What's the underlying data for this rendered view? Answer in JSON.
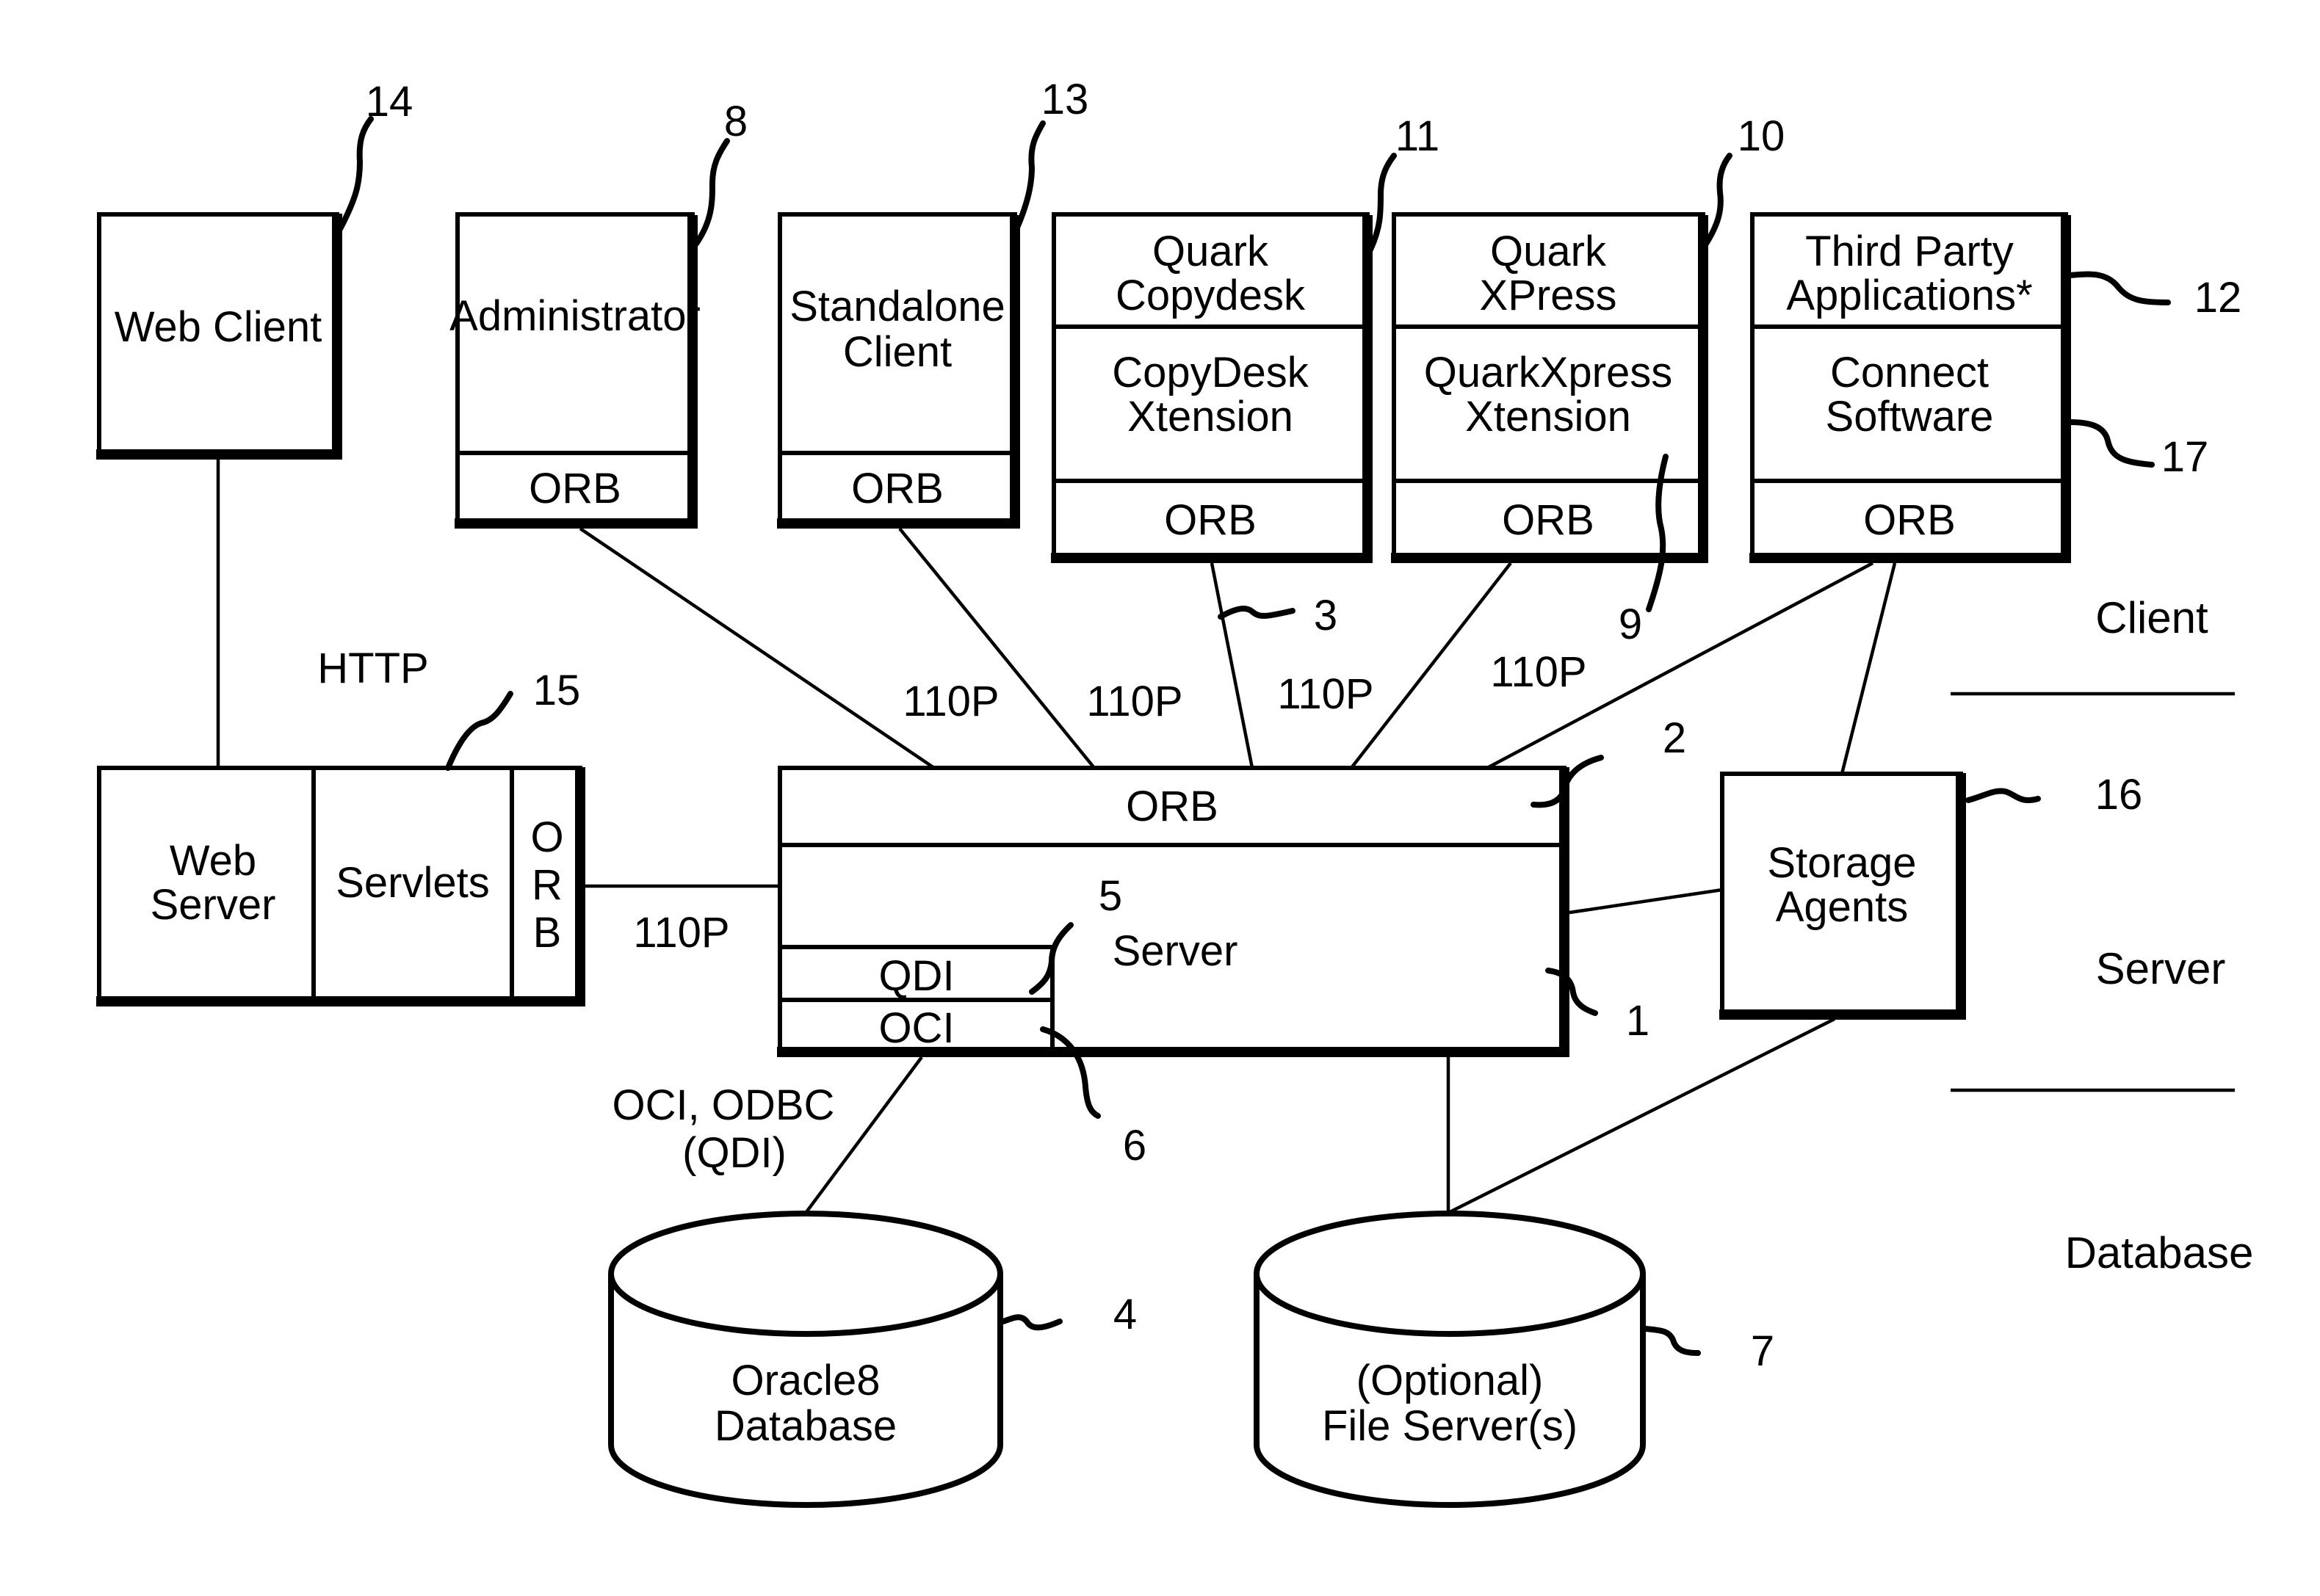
{
  "figure": {
    "type": "system-architecture",
    "tiers": {
      "client": "Client",
      "server": "Server",
      "database": "Database"
    },
    "protocols": {
      "http": "HTTP",
      "iiop": "110P",
      "db_access_line1": "OCI, ODBC",
      "db_access_line2": "(QDI)"
    },
    "components": {
      "web_client": {
        "label": "Web Client",
        "ref": "14"
      },
      "administrator": {
        "label": "Administrator",
        "orb": "ORB",
        "ref": "8"
      },
      "standalone_client": {
        "label_line1": "Standalone",
        "label_line2": "Client",
        "orb": "ORB",
        "ref": "13"
      },
      "quark_copydesk": {
        "app_line1": "Quark",
        "app_line2": "Copydesk",
        "ext_line1": "CopyDesk",
        "ext_line2": "Xtension",
        "orb": "ORB",
        "ref": "11"
      },
      "quark_xpress": {
        "app_line1": "Quark",
        "app_line2": "XPress",
        "ext_line1": "QuarkXpress",
        "ext_line2": "Xtension",
        "orb": "ORB",
        "ref": "10",
        "ext_ref": "9"
      },
      "third_party": {
        "app_line1": "Third Party",
        "app_line2": "Applications*",
        "ext_line1": "Connect",
        "ext_line2": "Software",
        "orb": "ORB",
        "ref": "12",
        "ext_ref": "17"
      },
      "web_server": {
        "label_line1": "Web",
        "label_line2": "Server",
        "servlets": "Servlets",
        "orb_chars": [
          "O",
          "R",
          "B"
        ],
        "ref": "15"
      },
      "server": {
        "orb": "ORB",
        "label": "Server",
        "qdi": "QDI",
        "oci": "OCI",
        "ref": "1",
        "orb_ref": "2",
        "qdi_ref": "5",
        "oci_ref": "6",
        "connection_ref": "3"
      },
      "storage_agents": {
        "label_line1": "Storage",
        "label_line2": "Agents",
        "ref": "16"
      },
      "oracle_db": {
        "label_line1": "Oracle8",
        "label_line2": "Database",
        "ref": "4"
      },
      "file_server": {
        "label_line1": "(Optional)",
        "label_line2": "File Server(s)",
        "ref": "7"
      }
    }
  }
}
